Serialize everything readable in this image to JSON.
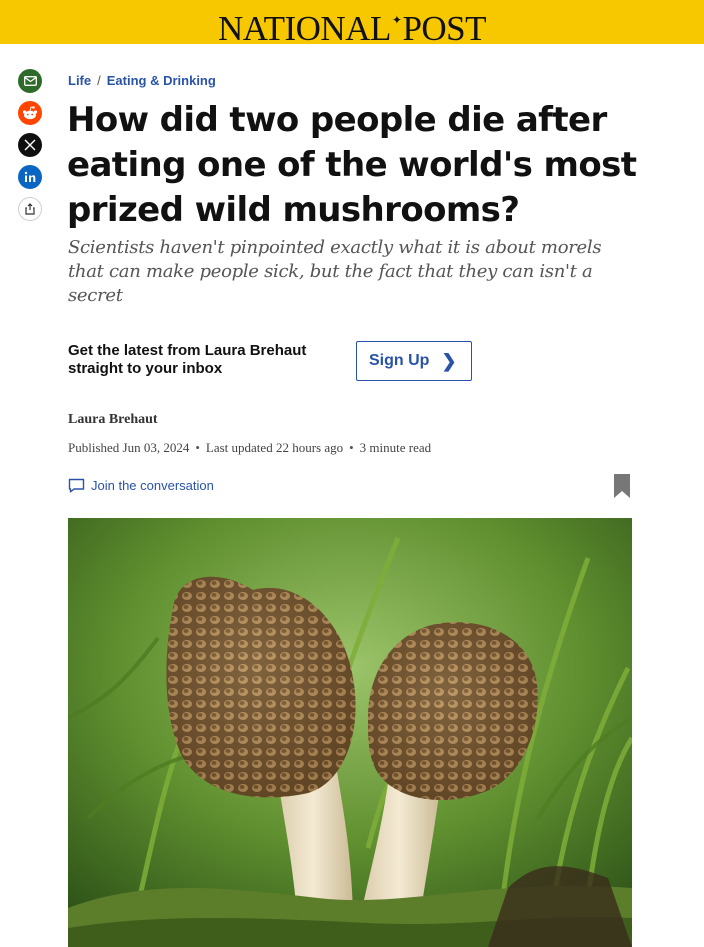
{
  "header": {
    "logo_left": "NATIONAL",
    "logo_right": "POST",
    "bg_color": "#f7c800"
  },
  "share": [
    {
      "name": "email-share",
      "icon": "envelope-icon",
      "color": "#2e6b2a"
    },
    {
      "name": "reddit-share",
      "icon": "reddit-icon",
      "color": "#ff4500"
    },
    {
      "name": "x-share",
      "icon": "x-icon",
      "color": "#0f0f0f"
    },
    {
      "name": "linkedin-share",
      "icon": "linkedin-icon",
      "color": "#0a66c2"
    },
    {
      "name": "more-share",
      "icon": "share-icon",
      "color": "#ffffff"
    }
  ],
  "breadcrumb": {
    "section": "Life",
    "separator": "/",
    "subsection": "Eating & Drinking"
  },
  "article": {
    "headline": "How did two people die after eating one of the world's most prized wild mushrooms?",
    "deck": "Scientists haven't pinpointed exactly what it is about morels that can make people sick, but the fact that they can isn't a secret"
  },
  "newsletter": {
    "text": "Get the latest from Laura Brehaut straight to your inbox",
    "button": "Sign Up"
  },
  "byline": {
    "author": "Laura Brehaut",
    "published": "Published Jun 03, 2024",
    "updated": "Last updated 22 hours ago",
    "read_time": "3 minute read"
  },
  "conversation": {
    "label": "Join the conversation"
  },
  "colors": {
    "link": "#2a53a8",
    "accent": "#f7c800"
  }
}
